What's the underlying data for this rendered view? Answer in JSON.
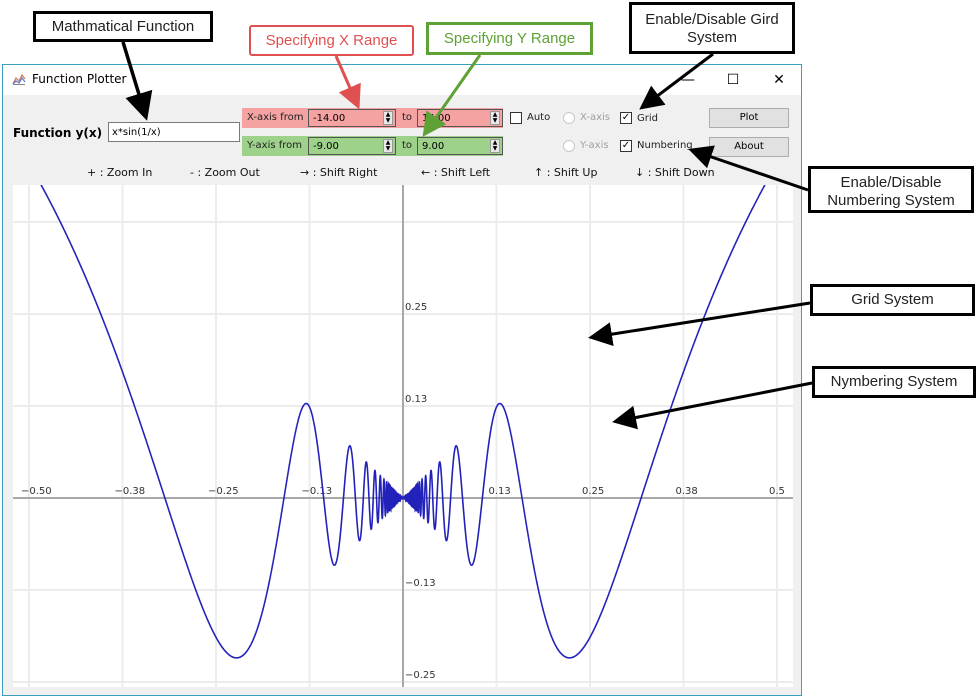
{
  "window": {
    "title": "Function Plotter",
    "controls": {
      "minimize": "—",
      "maximize": "☐",
      "close": "✕"
    }
  },
  "function": {
    "label": "Function y(x)",
    "value": "x*sin(1/x)"
  },
  "x_range": {
    "label": "X-axis from",
    "from": "-14.00",
    "to_label": "to",
    "to": "14.00",
    "color": "#f4a2a2"
  },
  "y_range": {
    "label": "Y-axis from",
    "from": "-9.00",
    "to_label": "to",
    "to": "9.00",
    "color": "#9ed18a"
  },
  "options": {
    "auto": {
      "label": "Auto",
      "checked": false
    },
    "x_axis_radio": {
      "label": "X-axis",
      "enabled": false
    },
    "y_axis_radio": {
      "label": "Y-axis",
      "enabled": false
    },
    "grid": {
      "label": "Grid",
      "checked": true
    },
    "numbering": {
      "label": "Numbering",
      "checked": true
    }
  },
  "buttons": {
    "plot": "Plot",
    "about": "About"
  },
  "hints": [
    "+ : Zoom In",
    "- : Zoom Out",
    "→ : Shift Right",
    "← : Shift Left",
    "↑ : Shift Up",
    "↓ : Shift Down"
  ],
  "annotations": {
    "math_function": "Mathmatical Function",
    "x_range": "Specifying X Range",
    "y_range": "Specifying Y Range",
    "grid_toggle_line1": "Enable/Disable Gird",
    "grid_toggle_line2": "System",
    "numbering_toggle_line1": "Enable/Disable",
    "numbering_toggle_line2": "Numbering System",
    "grid_system": "Grid System",
    "numbering_system": "Nymbering System"
  },
  "chart_data": {
    "type": "line",
    "function": "x*sin(1/x)",
    "line_color": "#2222bb",
    "grid": true,
    "numbering": true,
    "x_tick_labels": [
      "−0.50",
      "−0.38",
      "−0.25",
      "−0.13",
      "0.13",
      "0.25",
      "0.38",
      "0.5"
    ],
    "x_ticks": [
      -0.5,
      -0.375,
      -0.25,
      -0.125,
      0.125,
      0.25,
      0.375,
      0.5
    ],
    "y_tick_labels": [
      "0.25",
      "0.13",
      "−0.13",
      "−0.25"
    ],
    "y_ticks": [
      0.25,
      0.125,
      -0.125,
      -0.25
    ],
    "xlim": [
      -0.52,
      0.52
    ],
    "ylim": [
      -0.34,
      0.33
    ]
  }
}
